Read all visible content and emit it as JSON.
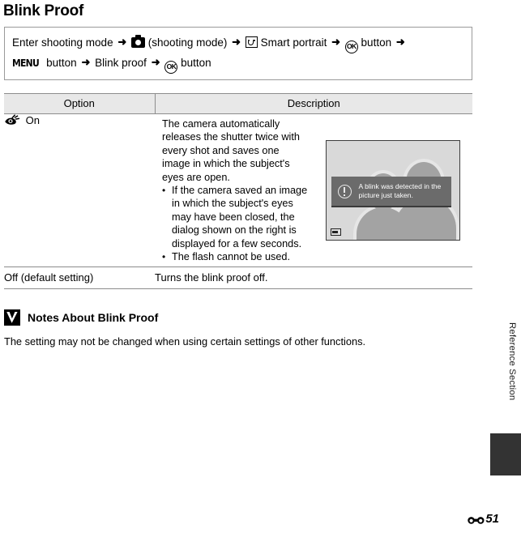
{
  "page": {
    "title": "Blink Proof",
    "page_number": "51",
    "sidebar_label": "Reference Section",
    "ref_glyph_name": "reference-section-symbol"
  },
  "instruction": {
    "line1": {
      "text_start": "Enter shooting mode",
      "arrow": "➜",
      "camera_label": "(shooting mode)",
      "smart_portrait": "Smart portrait",
      "ok_button": "button",
      "ok_label": "OK"
    },
    "line2": {
      "menu_glyph": "MENU",
      "menu_button": "button",
      "item": "Blink proof",
      "ok_label": "OK",
      "ok_button": "button"
    }
  },
  "table": {
    "headers": [
      "Option",
      "Description"
    ],
    "rows": [
      {
        "option": "On",
        "option_icon": "blink-proof-eye-icon",
        "description_intro": "The camera automatically releases the shutter twice with every shot and saves one image in which the subject's eyes are open.",
        "bullets": [
          "If the camera saved an image in which the subject's eyes may have been closed, the dialog shown on the right is displayed for a few seconds.",
          "The flash cannot be used."
        ],
        "bullet_marker": "•"
      },
      {
        "option": "Off (default setting)",
        "description": "Turns the blink proof off."
      }
    ]
  },
  "camera_screen": {
    "dialog_text_line1": "A blink was detected in the",
    "dialog_text_line2": "picture just taken.",
    "dialog_icon": "exclamation-circle-icon",
    "badge_icon": "monitor-icon"
  },
  "notes": {
    "icon": "caution-check-icon",
    "heading": "Notes About Blink Proof",
    "body": "The setting may not be changed when using certain settings of other functions."
  },
  "colors": {
    "table_border": "#8c8c8c",
    "table_header_bg": "#e8e8e8",
    "dialog_bg": "#6b6b6b",
    "sidebar_block": "#333333",
    "screen_bg": "#d9d9d9",
    "silhouette": "#a3a3a3"
  }
}
